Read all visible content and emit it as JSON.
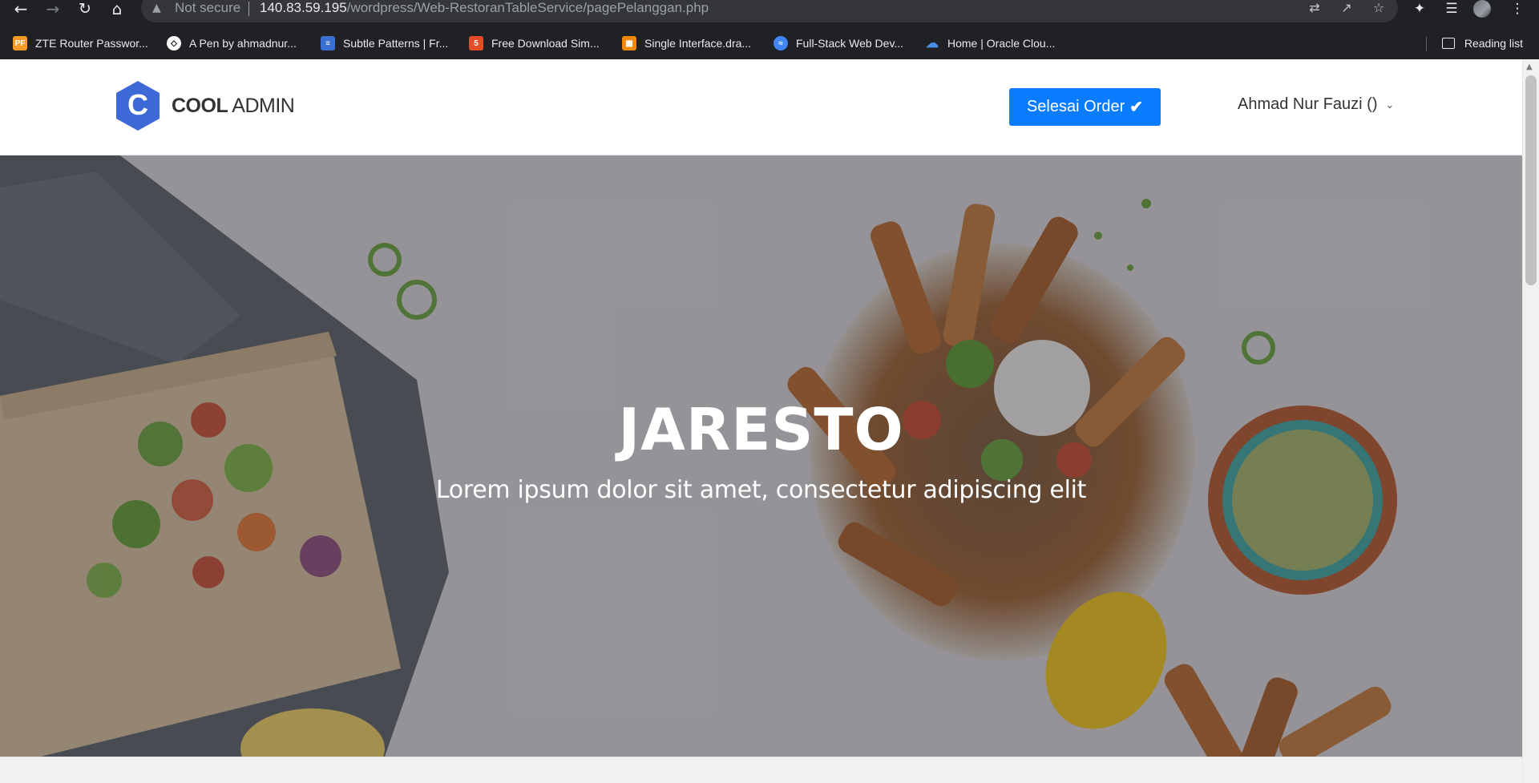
{
  "browser": {
    "security_label": "Not secure",
    "url_host": "140.83.59.195",
    "url_path": "/wordpress/Web-RestoranTableService/pagePelanggan.php",
    "bookmarks": [
      {
        "label": "ZTE Router Passwor...",
        "icon": "pf-icon",
        "color": "#f59a23"
      },
      {
        "label": "A Pen by ahmadnur...",
        "icon": "codepen-icon",
        "color": "#ffffff"
      },
      {
        "label": "Subtle Patterns | Fr...",
        "icon": "subtle-patterns-icon",
        "color": "#3b6fd1"
      },
      {
        "label": "Free Download Sim...",
        "icon": "html5-icon",
        "color": "#e44d26"
      },
      {
        "label": "Single Interface.dra...",
        "icon": "drawio-icon",
        "color": "#f08705"
      },
      {
        "label": "Full-Stack Web Dev...",
        "icon": "fullstack-icon",
        "color": "#4285f4"
      },
      {
        "label": "Home | Oracle Clou...",
        "icon": "cloud-icon",
        "color": "#4a8fe7"
      }
    ],
    "reading_list_label": "Reading list"
  },
  "header": {
    "logo_letter": "C",
    "logo_bold": "COOL",
    "logo_light": "ADMIN",
    "order_button_label": "Selesai Order",
    "user_name": "Ahmad Nur Fauzi ()"
  },
  "hero": {
    "title": "JARESTO",
    "subtitle": "Lorem ipsum dolor sit amet, consectetur adipiscing elit"
  },
  "colors": {
    "primary_button": "#0a7cff",
    "logo_blue": "#3d6ad6"
  }
}
